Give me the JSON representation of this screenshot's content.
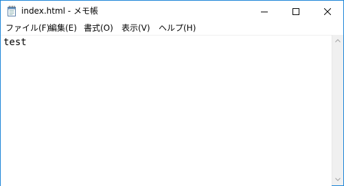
{
  "window": {
    "title": "index.html - メモ帳"
  },
  "menu": [
    {
      "label": "ファイル(F)"
    },
    {
      "label": "編集(E)"
    },
    {
      "label": "書式(O)"
    },
    {
      "label": "表示(V)"
    },
    {
      "label": "ヘルプ(H)"
    }
  ],
  "editor": {
    "content": "test"
  },
  "icons": {
    "app": "notepad-icon",
    "minimize": "minimize-icon",
    "maximize": "maximize-icon",
    "close": "close-icon",
    "scroll_up": "scroll-up-arrow-icon",
    "scroll_down": "scroll-down-arrow-icon"
  },
  "colors": {
    "window_border": "#1883d7",
    "scrollbar_track": "#f0f0f0"
  }
}
